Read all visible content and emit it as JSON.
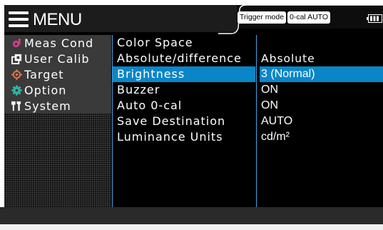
{
  "header": {
    "title": "MENU",
    "trigger_badge": "Trigger mode",
    "cal_badge": "0-cal AUTO"
  },
  "sidebar": {
    "items": [
      {
        "label": "Meas Cond",
        "icon": "meas-cond-icon",
        "icon_color": "#d93a8a"
      },
      {
        "label": "User Calib",
        "icon": "user-calib-icon",
        "icon_color": "#ffffff"
      },
      {
        "label": "Target",
        "icon": "target-icon",
        "icon_color": "#e8734a"
      },
      {
        "label": "Option",
        "icon": "option-gear-icon",
        "icon_color": "#2fb4a8"
      },
      {
        "label": "System",
        "icon": "system-tools-icon",
        "icon_color": "#ffffff"
      }
    ]
  },
  "menu": {
    "items": [
      {
        "label": "Color Space",
        "value": ""
      },
      {
        "label": "Absolute/difference",
        "value": "Absolute"
      },
      {
        "label": "Brightness",
        "value": "3 (Normal)"
      },
      {
        "label": "Buzzer",
        "value": "ON"
      },
      {
        "label": "Auto 0-cal",
        "value": "ON"
      },
      {
        "label": "Save Destination",
        "value": "AUTO"
      },
      {
        "label": "Luminance Units",
        "value": "cd/m²"
      }
    ],
    "selected_index": 2
  },
  "colors": {
    "selected": "#0a86c8",
    "divider": "#4aa3e0"
  }
}
